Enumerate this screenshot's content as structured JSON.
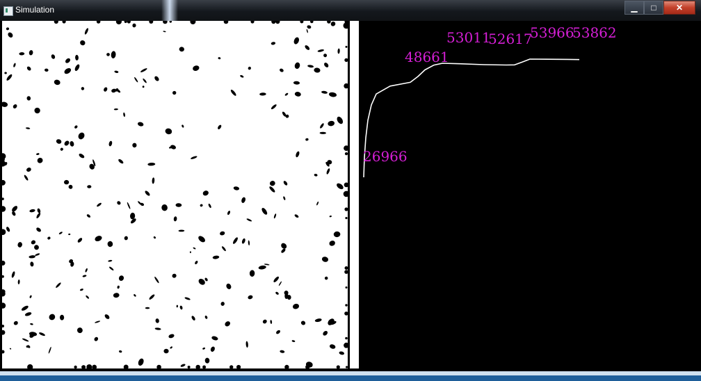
{
  "window": {
    "title": "Simulation",
    "minimize_icon": "minimize-icon",
    "maximize_icon": "maximize-icon",
    "close_icon": "close-icon"
  },
  "simulation": {
    "foreground": "#ffffff",
    "background": "#000000"
  },
  "chart_data": {
    "type": "line",
    "line_color": "#ffffff",
    "label_color": "#d51fd5",
    "series": [
      {
        "values": [
          26966,
          31500,
          36000,
          40000,
          43500,
          46000,
          47800,
          48661,
          50000,
          51500,
          52600,
          53011,
          52900,
          52700,
          52617,
          52650,
          53300,
          53966,
          53930,
          53900,
          53862
        ]
      }
    ],
    "point_labels": [
      "26966",
      "48661",
      "53011",
      "52617",
      "53966",
      "53862"
    ]
  }
}
